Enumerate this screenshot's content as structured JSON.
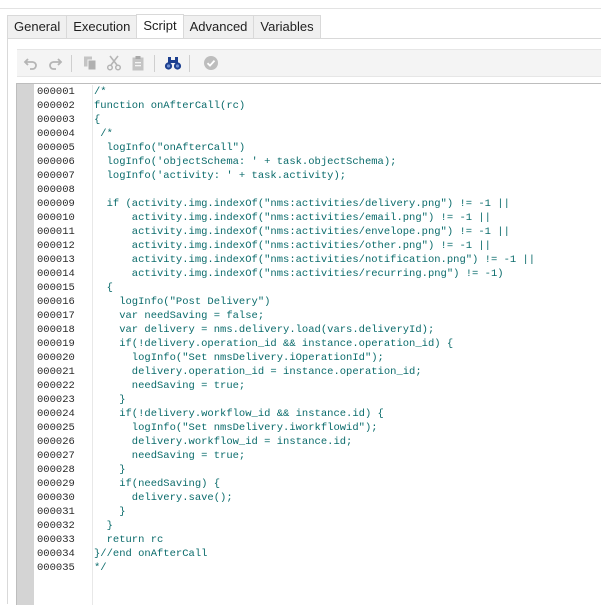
{
  "tabs": [
    {
      "label": "General",
      "active": false
    },
    {
      "label": "Execution",
      "active": false
    },
    {
      "label": "Script",
      "active": true
    },
    {
      "label": "Advanced",
      "active": false
    },
    {
      "label": "Variables",
      "active": false
    }
  ],
  "toolbar": {
    "buttons": [
      {
        "icon": "undo-icon",
        "enabled": false
      },
      {
        "icon": "redo-icon",
        "enabled": false
      },
      {
        "icon": "copy-icon",
        "enabled": false
      },
      {
        "icon": "cut-icon",
        "enabled": false
      },
      {
        "icon": "paste-icon",
        "enabled": false
      },
      {
        "icon": "find-binoculars-icon",
        "enabled": true
      },
      {
        "icon": "check-syntax-icon",
        "enabled": false
      }
    ]
  },
  "colors": {
    "code_text": "#0a6b6b",
    "line_number_text": "#2b2b2b",
    "gutter": "#d4d4d4",
    "binoculars": "#1c3f8f"
  },
  "editor": {
    "line_numbers": [
      "000001",
      "000002",
      "000003",
      "000004",
      "000005",
      "000006",
      "000007",
      "000008",
      "000009",
      "000010",
      "000011",
      "000012",
      "000013",
      "000014",
      "000015",
      "000016",
      "000017",
      "000018",
      "000019",
      "000020",
      "000021",
      "000022",
      "000023",
      "000024",
      "000025",
      "000026",
      "000027",
      "000028",
      "000029",
      "000030",
      "000031",
      "000032",
      "000033",
      "000034",
      "000035"
    ],
    "lines": [
      "/*",
      "function onAfterCall(rc)",
      "{",
      " /*",
      "  logInfo(\"onAfterCall\")",
      "  logInfo('objectSchema: ' + task.objectSchema);",
      "  logInfo('activity: ' + task.activity);",
      "",
      "  if (activity.img.indexOf(\"nms:activities/delivery.png\") != -1 ||",
      "      activity.img.indexOf(\"nms:activities/email.png\") != -1 ||",
      "      activity.img.indexOf(\"nms:activities/envelope.png\") != -1 ||",
      "      activity.img.indexOf(\"nms:activities/other.png\") != -1 ||",
      "      activity.img.indexOf(\"nms:activities/notification.png\") != -1 ||",
      "      activity.img.indexOf(\"nms:activities/recurring.png\") != -1)",
      "  {",
      "    logInfo(\"Post Delivery\")",
      "    var needSaving = false;",
      "    var delivery = nms.delivery.load(vars.deliveryId);",
      "    if(!delivery.operation_id && instance.operation_id) {",
      "      logInfo(\"Set nmsDelivery.iOperationId\");",
      "      delivery.operation_id = instance.operation_id;",
      "      needSaving = true;",
      "    }",
      "    if(!delivery.workflow_id && instance.id) {",
      "      logInfo(\"Set nmsDelivery.iworkflowid\");",
      "      delivery.workflow_id = instance.id;",
      "      needSaving = true;",
      "    }",
      "    if(needSaving) {",
      "      delivery.save();",
      "    }",
      "  }",
      "  return rc",
      "}//end onAfterCall",
      "*/"
    ]
  }
}
